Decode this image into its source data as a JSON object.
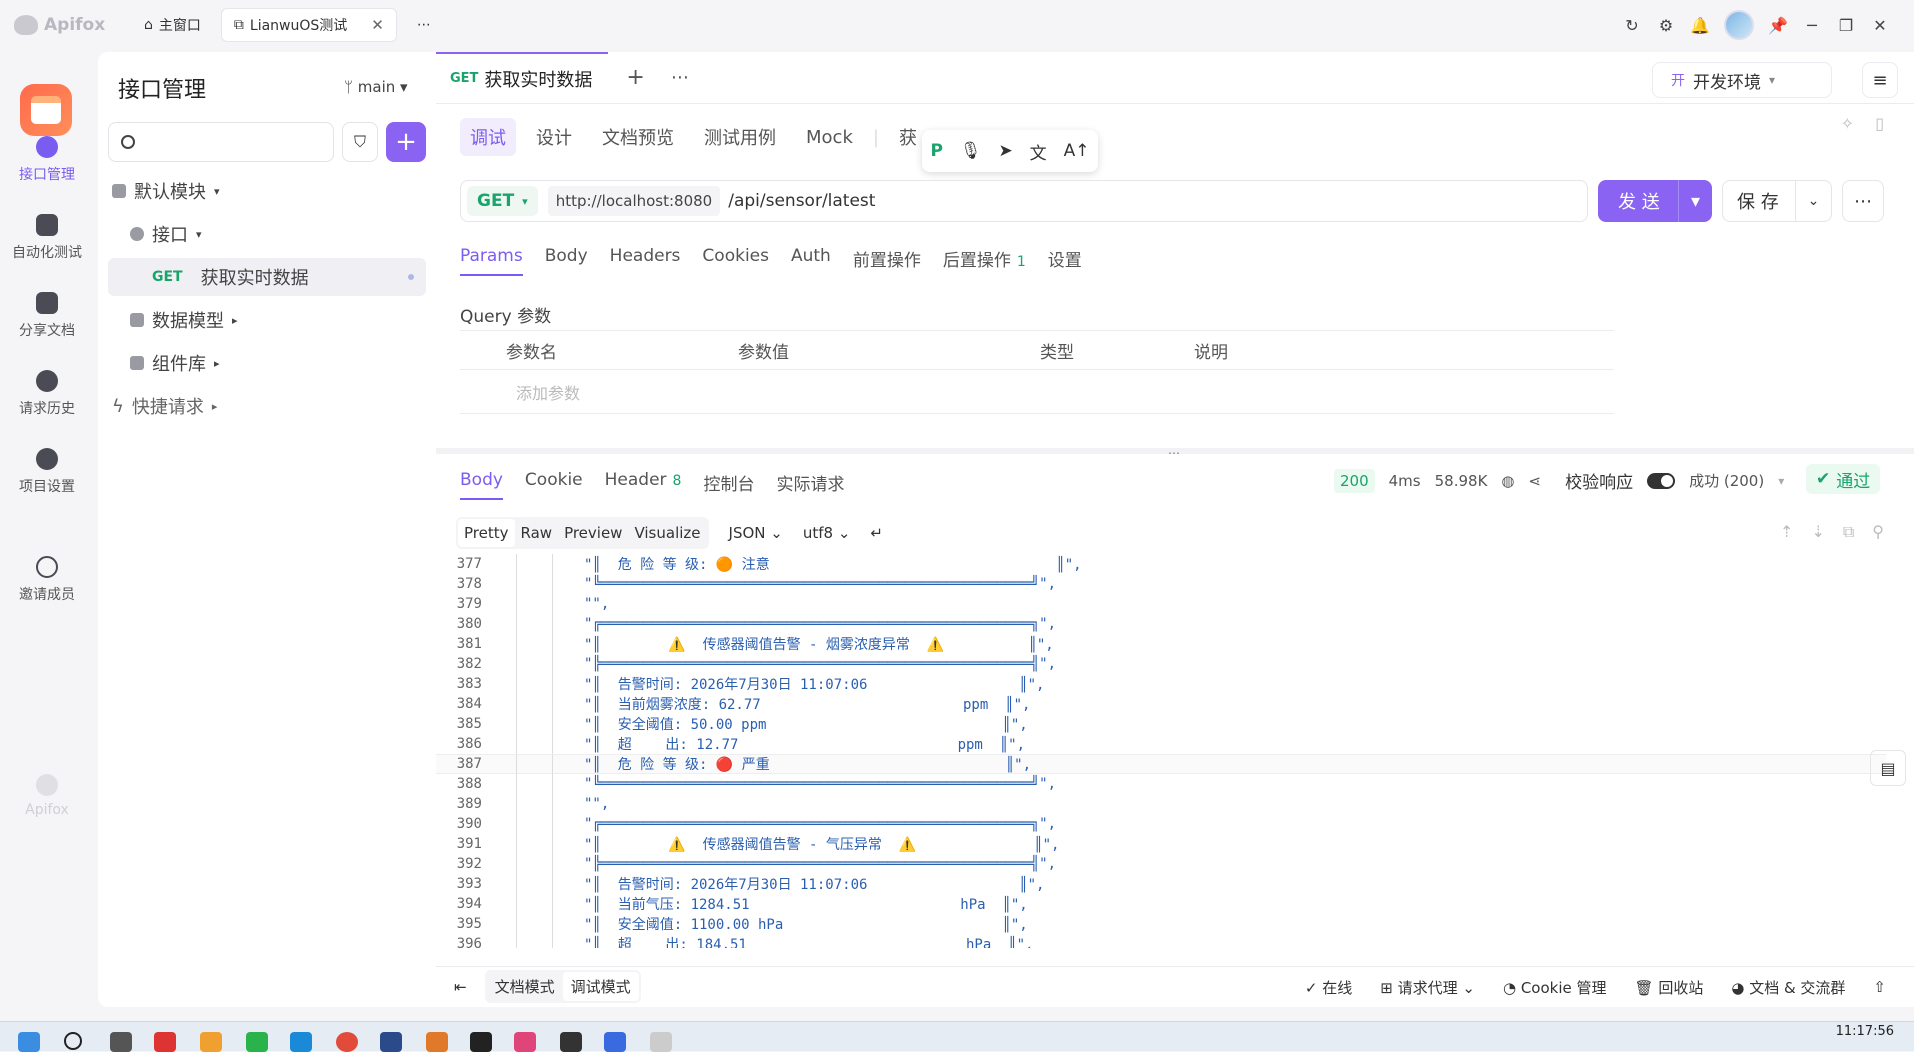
{
  "app": {
    "name": "Apifox"
  },
  "window_tabs": [
    {
      "label": "主窗口"
    },
    {
      "label": "LianwuOS测试"
    }
  ],
  "sidebar": {
    "items": [
      {
        "label": "接口管理"
      },
      {
        "label": "自动化测试"
      },
      {
        "label": "分享文档"
      },
      {
        "label": "请求历史"
      },
      {
        "label": "项目设置"
      },
      {
        "label": "邀请成员"
      }
    ]
  },
  "panel": {
    "title": "接口管理",
    "branch": "main",
    "tree": [
      {
        "label": "默认模块"
      },
      {
        "label": "接口"
      },
      {
        "method": "GET",
        "label": "获取实时数据"
      },
      {
        "label": "数据模型"
      },
      {
        "label": "组件库"
      },
      {
        "label": "快捷请求"
      }
    ]
  },
  "api_tab": {
    "method": "GET",
    "title": "获取实时数据"
  },
  "env": {
    "prefix": "开",
    "label": "开发环境"
  },
  "sub_tabs": [
    "调试",
    "设计",
    "文档预览",
    "测试用例",
    "Mock",
    "获"
  ],
  "request": {
    "method": "GET",
    "host": "http://localhost:8080",
    "path": "/api/sensor/latest",
    "send": "发 送",
    "save": "保 存"
  },
  "req_tabs": [
    "Params",
    "Body",
    "Headers",
    "Cookies",
    "Auth",
    "前置操作",
    "后置操作",
    "设置"
  ],
  "post_count": "1",
  "query": {
    "title": "Query 参数",
    "headers": [
      "参数名",
      "参数值",
      "类型",
      "说明"
    ],
    "placeholder": "添加参数"
  },
  "resp_tabs": [
    "Body",
    "Cookie",
    "Header",
    "控制台",
    "实际请求"
  ],
  "header_count": "8",
  "resp_meta": {
    "status": "200",
    "time": "4ms",
    "size": "58.98K",
    "validate": "校验响应",
    "result": "成功 (200)",
    "pass": "通过"
  },
  "view": {
    "modes": [
      "Pretty",
      "Raw",
      "Preview",
      "Visualize"
    ],
    "format": "JSON",
    "encoding": "utf8"
  },
  "code_lines": [
    {
      "n": "377",
      "t": "\"║  危 险 等 级: 🟠 注意                                  ║\","
    },
    {
      "n": "378",
      "t": "\"╚═══════════════════════════════════════════════════╝\","
    },
    {
      "n": "379",
      "t": "\"\","
    },
    {
      "n": "380",
      "t": "\"╔═══════════════════════════════════════════════════╗\","
    },
    {
      "n": "381",
      "t": "\"║        ⚠️  传感器阈值告警 - 烟雾浓度异常  ⚠️          ║\","
    },
    {
      "n": "382",
      "t": "\"╠═══════════════════════════════════════════════════╣\","
    },
    {
      "n": "383",
      "t": "\"║  告警时间: 2026年7月30日 11:07:06                  ║\","
    },
    {
      "n": "384",
      "t": "\"║  当前烟雾浓度: 62.77                        ppm  ║\","
    },
    {
      "n": "385",
      "t": "\"║  安全阈值: 50.00 ppm                            ║\","
    },
    {
      "n": "386",
      "t": "\"║  超    出: 12.77                          ppm  ║\","
    },
    {
      "n": "387",
      "t": "\"║  危 险 等 级: 🔴 严重                            ║\","
    },
    {
      "n": "388",
      "t": "\"╚═══════════════════════════════════════════════════╝\","
    },
    {
      "n": "389",
      "t": "\"\","
    },
    {
      "n": "390",
      "t": "\"╔═══════════════════════════════════════════════════╗\","
    },
    {
      "n": "391",
      "t": "\"║        ⚠️  传感器阈值告警 - 气压异常  ⚠️              ║\","
    },
    {
      "n": "392",
      "t": "\"╠═══════════════════════════════════════════════════╣\","
    },
    {
      "n": "393",
      "t": "\"║  告警时间: 2026年7月30日 11:07:06                  ║\","
    },
    {
      "n": "394",
      "t": "\"║  当前气压: 1284.51                         hPa  ║\","
    },
    {
      "n": "395",
      "t": "\"║  安全阈值: 1100.00 hPa                          ║\","
    },
    {
      "n": "396",
      "t": "\"║  超    出: 184.51                          hPa  ║\","
    }
  ],
  "bottom": {
    "modes": [
      "文档模式",
      "调试模式"
    ],
    "items": [
      "在线",
      "请求代理",
      "Cookie 管理",
      "回收站",
      "文档 & 交流群"
    ]
  },
  "clock": "11:17:56"
}
